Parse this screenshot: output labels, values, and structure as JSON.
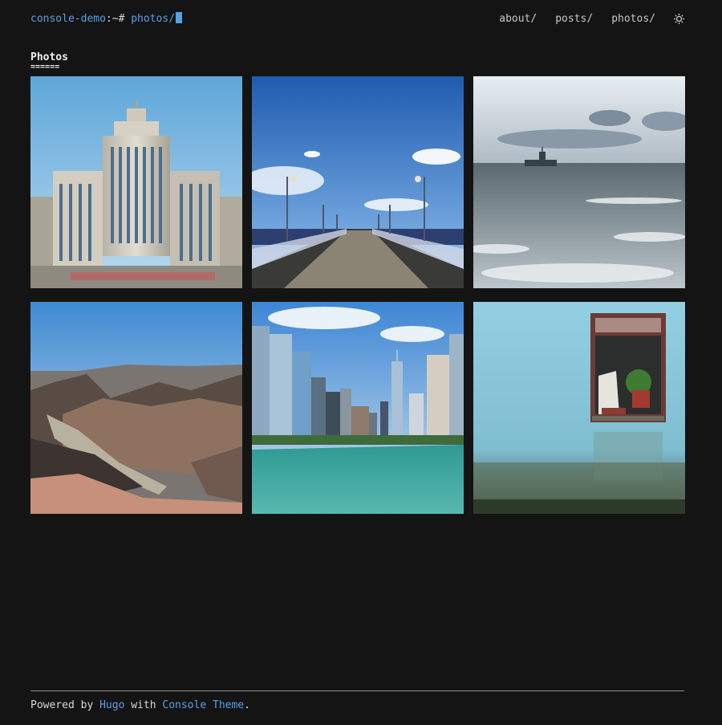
{
  "header": {
    "site": "console-demo",
    "prompt_sep": ":~# ",
    "path": "photos/"
  },
  "nav": {
    "items": [
      {
        "label": "about/"
      },
      {
        "label": "posts/"
      },
      {
        "label": "photos/"
      }
    ],
    "theme_icon": "theme-toggle-icon"
  },
  "page": {
    "title": "Photos",
    "underline": "======"
  },
  "photos": [
    {
      "name": "palace-of-culture"
    },
    {
      "name": "pier-walkway"
    },
    {
      "name": "stormy-sea-boat"
    },
    {
      "name": "grand-canyon"
    },
    {
      "name": "city-river-skyline"
    },
    {
      "name": "blue-wall-window"
    }
  ],
  "footer": {
    "prefix": "Powered by ",
    "hugo": "Hugo",
    "middle": " with ",
    "theme": "Console Theme",
    "suffix": "."
  }
}
